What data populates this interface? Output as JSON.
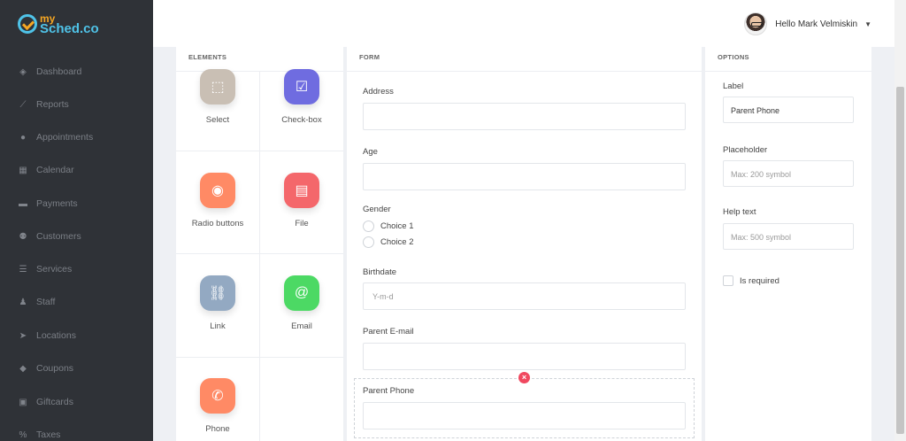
{
  "brand": {
    "logo_top": "my",
    "logo_main": "Sched.co"
  },
  "sidebar": {
    "items": [
      {
        "label": "Dashboard",
        "icon": "dashboard-icon"
      },
      {
        "label": "Reports",
        "icon": "chart-icon"
      },
      {
        "label": "Appointments",
        "icon": "clock-icon"
      },
      {
        "label": "Calendar",
        "icon": "calendar-icon"
      },
      {
        "label": "Payments",
        "icon": "wallet-icon"
      },
      {
        "label": "Customers",
        "icon": "users-icon"
      },
      {
        "label": "Services",
        "icon": "list-icon"
      },
      {
        "label": "Staff",
        "icon": "user-icon"
      },
      {
        "label": "Locations",
        "icon": "location-arrow-icon"
      },
      {
        "label": "Coupons",
        "icon": "tag-icon"
      },
      {
        "label": "Giftcards",
        "icon": "gift-icon"
      },
      {
        "label": "Taxes",
        "icon": "percent-icon"
      }
    ]
  },
  "header": {
    "greeting": "Hello Mark Velmiskin"
  },
  "elements_panel": {
    "title": "ELEMENTS",
    "items": [
      {
        "label": "Select",
        "icon": "select-icon",
        "color": "#c9bfb4"
      },
      {
        "label": "Check-box",
        "icon": "checkbox-icon",
        "color": "#6f6ce0"
      },
      {
        "label": "Radio buttons",
        "icon": "radio-icon",
        "color": "#ff8a65"
      },
      {
        "label": "File",
        "icon": "file-icon",
        "color": "#f4676b"
      },
      {
        "label": "Link",
        "icon": "link-icon",
        "color": "#93a9c2"
      },
      {
        "label": "Email",
        "icon": "at-icon",
        "color": "#4cd964"
      },
      {
        "label": "Phone",
        "icon": "phone-icon",
        "color": "#ff8a65"
      }
    ]
  },
  "form_panel": {
    "title": "FORM",
    "fields": {
      "address": {
        "label": "Address",
        "value": ""
      },
      "age": {
        "label": "Age",
        "value": ""
      },
      "gender": {
        "label": "Gender",
        "choices": [
          "Choice 1",
          "Choice 2"
        ]
      },
      "birthdate": {
        "label": "Birthdate",
        "placeholder": "Y-m-d"
      },
      "parent_email": {
        "label": "Parent E-mail",
        "value": ""
      },
      "parent_phone": {
        "label": "Parent Phone",
        "value": ""
      }
    }
  },
  "options_panel": {
    "title": "OPTIONS",
    "label": {
      "label": "Label",
      "value": "Parent Phone"
    },
    "placeholder": {
      "label": "Placeholder",
      "placeholder": "Max: 200 symbol"
    },
    "help_text": {
      "label": "Help text",
      "placeholder": "Max: 500 symbol"
    },
    "required_label": "Is required"
  }
}
